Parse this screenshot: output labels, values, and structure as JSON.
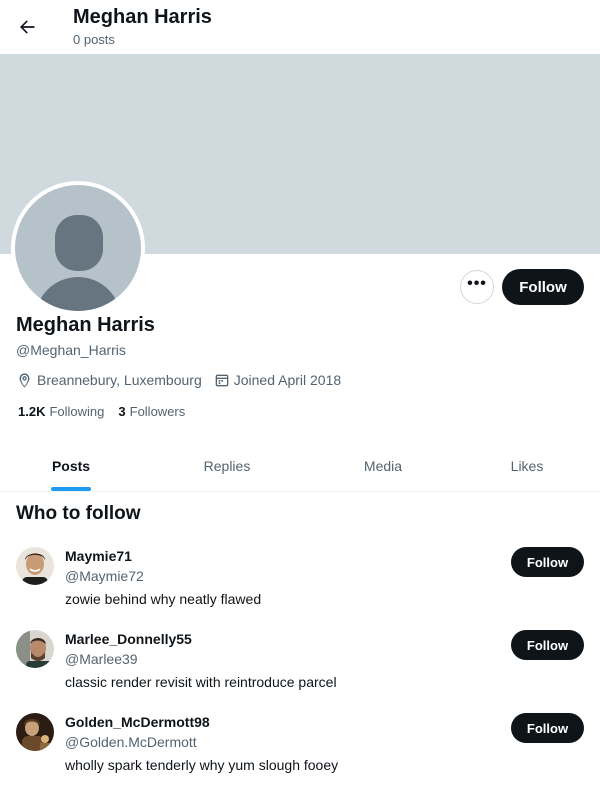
{
  "header": {
    "title": "Meghan Harris",
    "subtitle": "0 posts",
    "back_icon": "arrow-left-icon"
  },
  "profile": {
    "name": "Meghan Harris",
    "handle": "@Meghan_Harris",
    "location": "Breannebury, Luxembourg",
    "joined": "Joined April 2018",
    "following_count": "1.2K",
    "following_label": "Following",
    "followers_count": "3",
    "followers_label": "Followers",
    "follow_label": "Follow",
    "more_label": "•••"
  },
  "tabs": [
    {
      "label": "Posts",
      "active": true
    },
    {
      "label": "Replies",
      "active": false
    },
    {
      "label": "Media",
      "active": false
    },
    {
      "label": "Likes",
      "active": false
    }
  ],
  "who_to_follow": {
    "title": "Who to follow",
    "users": [
      {
        "name": "Maymie71",
        "handle": "@Maymie72",
        "bio": "zowie behind why neatly flawed",
        "follow_label": "Follow"
      },
      {
        "name": "Marlee_Donnelly55",
        "handle": "@Marlee39",
        "bio": "classic render revisit with reintroduce parcel",
        "follow_label": "Follow"
      },
      {
        "name": "Golden_McDermott98",
        "handle": "@Golden.McDermott",
        "bio": "wholly spark tenderly why yum slough fooey",
        "follow_label": "Follow"
      }
    ]
  },
  "colors": {
    "accent": "#1d9bf0",
    "banner": "#cfd9de",
    "text": "#0f1419",
    "muted": "#536471",
    "button": "#0f1419"
  }
}
